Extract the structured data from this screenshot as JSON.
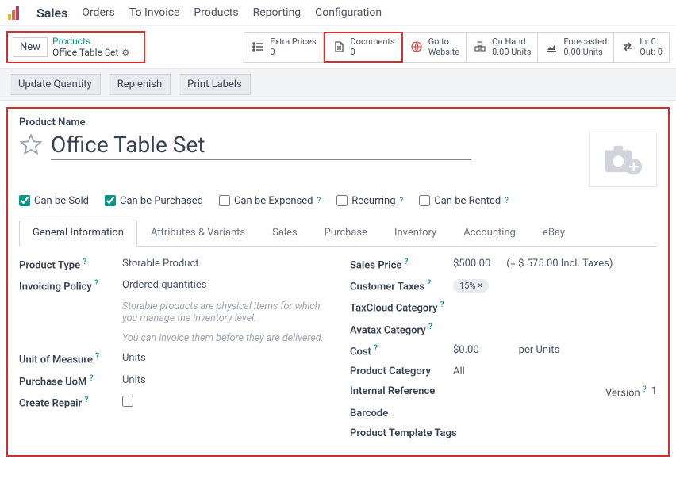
{
  "menu": {
    "app_name": "Sales",
    "items": [
      "Orders",
      "To Invoice",
      "Products",
      "Reporting",
      "Configuration"
    ]
  },
  "breadcrumb": {
    "new_label": "New",
    "parent": "Products",
    "current": "Office Table Set"
  },
  "stat_buttons": {
    "extra_prices": {
      "label": "Extra Prices",
      "value": "0"
    },
    "documents": {
      "label": "Documents",
      "value": "0"
    },
    "goto_website": {
      "label": "Go to",
      "value": "Website"
    },
    "on_hand": {
      "label": "On Hand",
      "value": "0.00 Units"
    },
    "forecasted": {
      "label": "Forecasted",
      "value": "0.00 Units"
    },
    "inout": {
      "in_label": "In: 0",
      "out_label": "Out: 0"
    }
  },
  "actions": {
    "update_quantity": "Update Quantity",
    "replenish": "Replenish",
    "print_labels": "Print Labels"
  },
  "form": {
    "product_name_label": "Product Name",
    "product_name": "Office Table Set",
    "checkboxes": {
      "can_sell": "Can be Sold",
      "can_purchase": "Can be Purchased",
      "can_expense": "Can be Expensed",
      "recurring": "Recurring",
      "can_rent": "Can be Rented"
    },
    "tabs": [
      "General Information",
      "Attributes & Variants",
      "Sales",
      "Purchase",
      "Inventory",
      "Accounting",
      "eBay"
    ],
    "left": {
      "product_type": {
        "label": "Product Type",
        "value": "Storable Product"
      },
      "invoicing_policy": {
        "label": "Invoicing Policy",
        "value": "Ordered quantities"
      },
      "help1": "Storable products are physical items for which you manage the inventory level.",
      "help2": "You can invoice them before they are delivered.",
      "uom": {
        "label": "Unit of Measure",
        "value": "Units"
      },
      "purchase_uom": {
        "label": "Purchase UoM",
        "value": "Units"
      },
      "create_repair": {
        "label": "Create Repair"
      }
    },
    "right": {
      "sales_price": {
        "label": "Sales Price",
        "value": "$500.00",
        "incl": "(= $ 575.00 Incl. Taxes)"
      },
      "customer_taxes": {
        "label": "Customer Taxes",
        "value": "15%"
      },
      "taxcloud": {
        "label": "TaxCloud Category"
      },
      "avatax": {
        "label": "Avatax Category"
      },
      "cost": {
        "label": "Cost",
        "value": "$0.00",
        "unit": "per Units"
      },
      "category": {
        "label": "Product Category",
        "value": "All"
      },
      "internal_ref": {
        "label": "Internal Reference"
      },
      "barcode": {
        "label": "Barcode"
      },
      "template_tags": {
        "label": "Product Template Tags"
      },
      "version": {
        "label": "Version",
        "value": "1"
      }
    }
  }
}
